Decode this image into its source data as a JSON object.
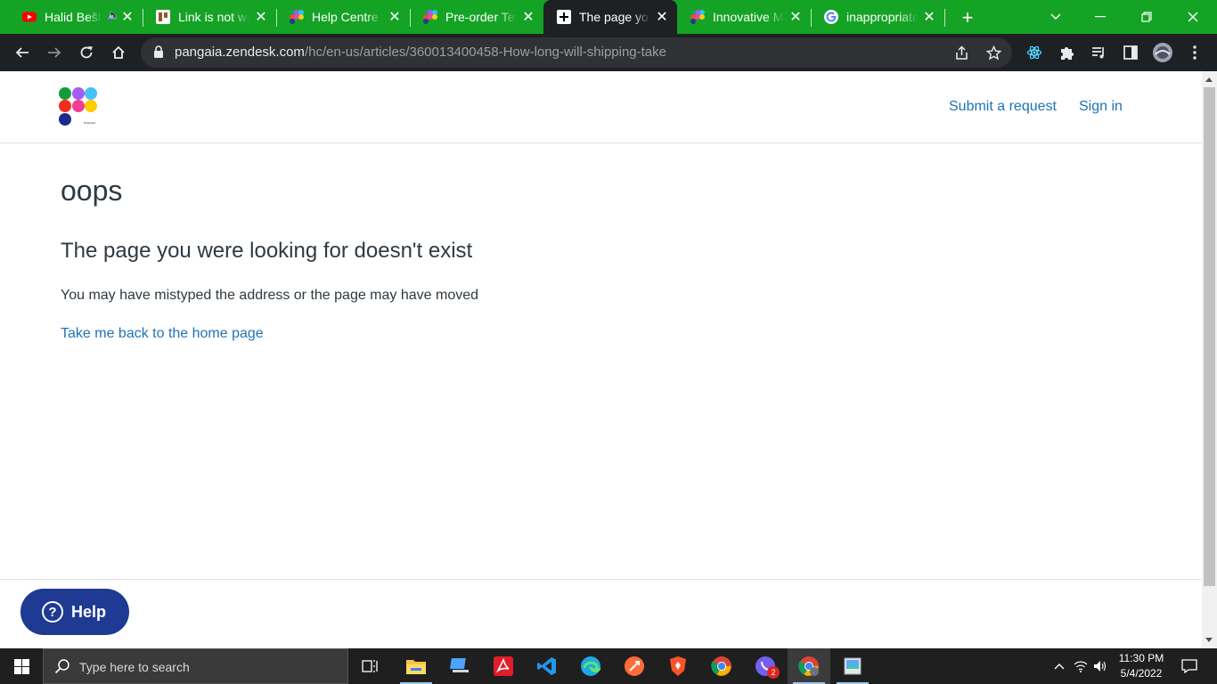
{
  "browser": {
    "tabs": [
      {
        "title": "Halid Bešlić",
        "icon": "youtube-icon",
        "audio": true,
        "active": false
      },
      {
        "title": "Link is not working",
        "icon": "trello-icon",
        "active": false
      },
      {
        "title": "Help Centre",
        "icon": "pangaia-icon",
        "active": false
      },
      {
        "title": "Pre-order Terms",
        "icon": "pangaia-icon",
        "active": false
      },
      {
        "title": "The page you were looking for",
        "icon": "zendesk-icon",
        "active": true
      },
      {
        "title": "Innovative Materials",
        "icon": "pangaia-icon",
        "active": false
      },
      {
        "title": "inappropriate",
        "icon": "google-icon",
        "active": false
      }
    ],
    "new_tab_label": "+",
    "url_host": "pangaia.zendesk.com",
    "url_path": "/hc/en-us/articles/360013400458-How-long-will-shipping-take"
  },
  "header": {
    "logo_word": "PANGAIA",
    "submit_request": "Submit a request",
    "sign_in": "Sign in"
  },
  "main": {
    "heading": "oops",
    "subheading": "The page you were looking for doesn't exist",
    "description": "You may have mistyped the address or the page may have moved",
    "home_link": "Take me back to the home page"
  },
  "help_widget": {
    "label": "Help"
  },
  "taskbar": {
    "search_placeholder": "Type here to search",
    "time": "11:30 PM",
    "date": "5/4/2022",
    "notification_count": "2"
  },
  "colors": {
    "tabstrip": "#15a326",
    "link": "#1f73b7",
    "help_button": "#1f3a93",
    "text": "#2f3941"
  }
}
